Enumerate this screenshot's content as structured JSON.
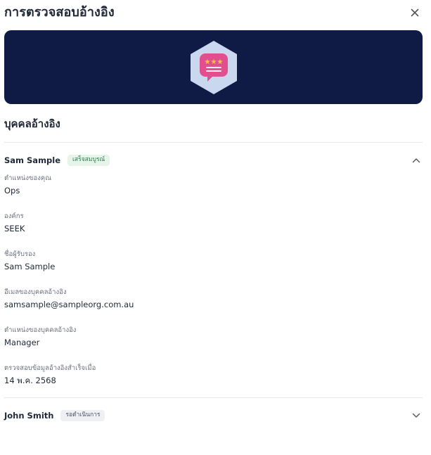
{
  "header": {
    "title": "การตรวจสอบอ้างอิง",
    "close_icon": "close-icon"
  },
  "banner": {
    "background": "#0f1a45",
    "icon": "review-chat-icon"
  },
  "section": {
    "title": "บุคคลอ้างอิง"
  },
  "referees": [
    {
      "name": "Sam Sample",
      "status": "เสร็จสมบูรณ์",
      "expanded": true,
      "fields": [
        {
          "label": "ตำแหน่งของคุณ",
          "value": "Ops"
        },
        {
          "label": "องค์กร",
          "value": "SEEK"
        },
        {
          "label": "ชื่อผู้รับรอง",
          "value": "Sam Sample"
        },
        {
          "label": "อีเมลของบุคคลอ้างอิง",
          "value": "samsample@sampleorg.com.au"
        },
        {
          "label": "ตำแหน่งของบุคคลอ้างอิง",
          "value": "Manager"
        },
        {
          "label": "ตรวจสอบข้อมูลอ้างอิงสำเร็จเมื่อ",
          "value": "14 พ.ค. 2568"
        }
      ]
    },
    {
      "name": "John Smith",
      "status": "รอดำเนินการ",
      "expanded": false
    }
  ],
  "colors": {
    "banner_bg": "#0f1a45",
    "badge_complete_bg": "#e6f4ea",
    "badge_complete_text": "#2e7d4f",
    "badge_pending_bg": "#eef0f3",
    "icon_pink": "#e24f8f",
    "icon_hex_bg": "#c9d8ef",
    "star_yellow": "#f5c542"
  }
}
